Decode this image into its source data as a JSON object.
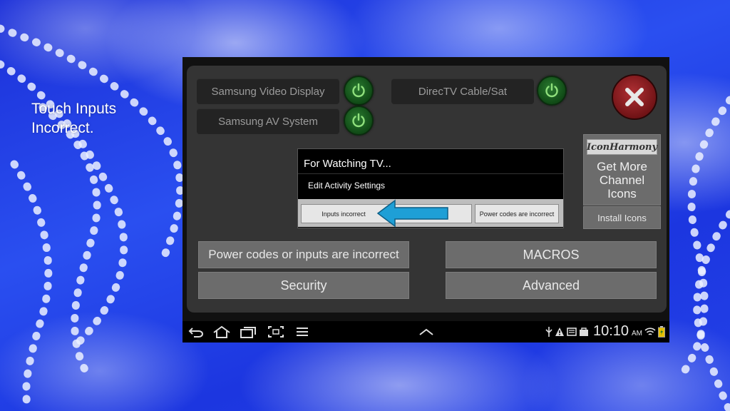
{
  "caption": {
    "line1": "Touch Inputs",
    "line2": "Incorrect."
  },
  "devices": [
    {
      "label": "Samsung Video Display"
    },
    {
      "label": "DirecTV Cable/Sat"
    },
    {
      "label": "Samsung AV System"
    }
  ],
  "icon_harmony": {
    "logo": "IconHarmony",
    "line1": "Get More",
    "line2": "Channel",
    "line3": "Icons"
  },
  "install_icons": "Install Icons",
  "dialog": {
    "title": "For Watching TV...",
    "item": "Edit Activity Settings",
    "btn_inputs": "Inputs incorrect",
    "btn_power": "Power codes are incorrect"
  },
  "buttons": {
    "power_inputs": "Power codes or inputs are incorrect",
    "macros": "MACROS",
    "security": "Security",
    "advanced": "Advanced"
  },
  "status": {
    "time": "10:10",
    "ampm": "AM"
  },
  "colors": {
    "arrow": "#1e9fd6",
    "power_green": "#1f6d27",
    "close_red": "#9a2226"
  },
  "icons": [
    "back-icon",
    "home-icon",
    "recent-apps-icon",
    "screenshot-icon",
    "menu-icon",
    "chevron-up-icon",
    "usb-icon",
    "warning-icon",
    "notification-icon",
    "store-icon",
    "wifi-icon",
    "battery-icon",
    "power-icon",
    "close-icon",
    "arrow-left-icon"
  ]
}
